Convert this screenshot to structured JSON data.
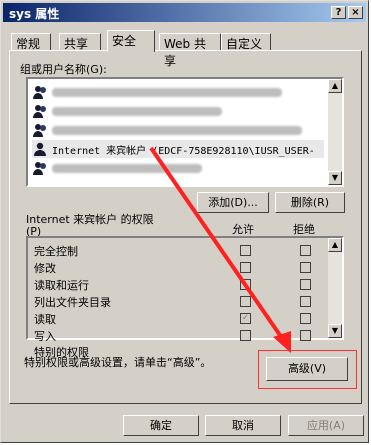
{
  "window": {
    "title": "sys 属性",
    "help": "?",
    "close": "×"
  },
  "tabs": [
    {
      "label": "常规"
    },
    {
      "label": "共享"
    },
    {
      "label": "安全"
    },
    {
      "label": "Web 共享"
    },
    {
      "label": "自定义"
    }
  ],
  "users": {
    "group_label": "组或用户名称(G):",
    "items": [
      {
        "label": ""
      },
      {
        "label": ""
      },
      {
        "label": ""
      },
      {
        "label": "Internet 来宾帐户  (EDCF-758E928110\\IUSR_USER-"
      },
      {
        "label": ""
      }
    ],
    "add_button": "添加(D)...",
    "remove_button": "删除(R)"
  },
  "permissions": {
    "title": "Internet 来宾帐户 的权限",
    "shortcut": "(P)",
    "allow_header": "允许",
    "deny_header": "拒绝",
    "rows": [
      {
        "label": "完全控制",
        "allow": false,
        "deny": false
      },
      {
        "label": "修改",
        "allow": false,
        "deny": false
      },
      {
        "label": "读取和运行",
        "allow": false,
        "deny": false
      },
      {
        "label": "列出文件夹目录",
        "allow": false,
        "deny": false
      },
      {
        "label": "读取",
        "allow": true,
        "deny": false
      },
      {
        "label": "写入",
        "allow": false,
        "deny": false
      },
      {
        "label": "特别的权限",
        "allow": false,
        "deny": false
      }
    ]
  },
  "advanced": {
    "hint": "特别权限或高级设置，请单击“高级”。",
    "button": "高级(V)"
  },
  "footer": {
    "ok": "确定",
    "cancel": "取消",
    "apply": "应用(A)"
  },
  "accent_colors": {
    "title_bar": "#0a246a",
    "highlight": "#ff3030"
  }
}
